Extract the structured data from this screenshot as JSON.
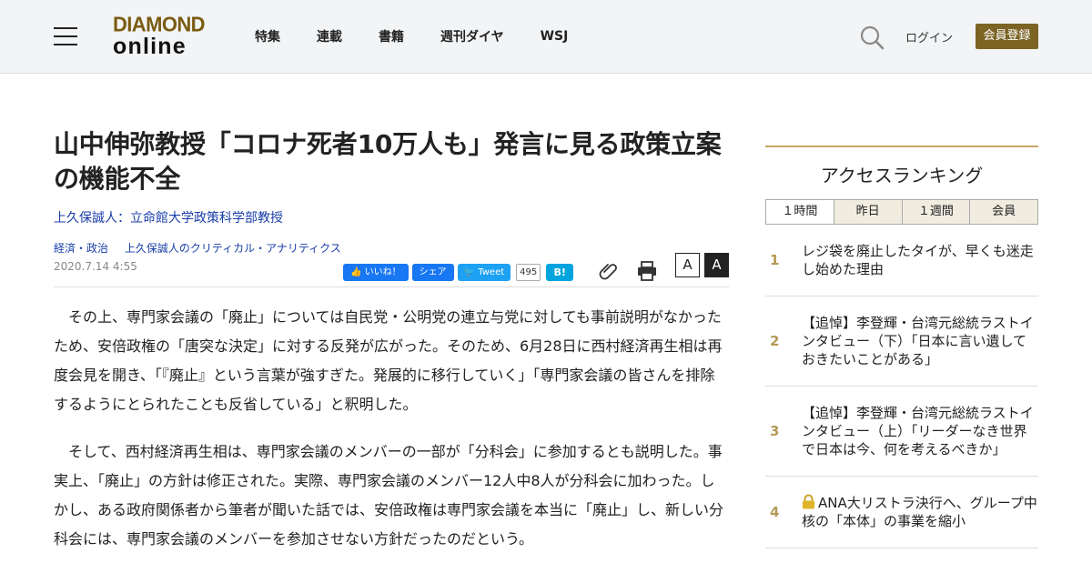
{
  "header": {
    "logo_top": "DIAMOND",
    "logo_bottom": "online",
    "nav": [
      "特集",
      "連載",
      "書籍",
      "週刊ダイヤ",
      "WSJ"
    ],
    "login": "ログイン",
    "register": "会員登録"
  },
  "article": {
    "title": "山中伸弥教授「コロナ死者10万人も」発言に見る政策立案の機能不全",
    "author": "上久保誠人：立命館大学政策科学部教授",
    "categories": [
      "経済・政治",
      "上久保誠人のクリティカル・アナリティクス"
    ],
    "date": "2020.7.14 4:55",
    "share": {
      "like": "いいね！",
      "share": "シェア",
      "tweet": "Tweet",
      "count": "495",
      "hatena": "B!"
    },
    "font_small": "A",
    "font_large": "A",
    "paragraphs": [
      "その上、専門家会議の「廃止」については自民党・公明党の連立与党に対しても事前説明がなかったため、安倍政権の「唐突な決定」に対する反発が広がった。そのため、6月28日に西村経済再生相は再度会見を開き、「『廃止』という言葉が強すぎた。発展的に移行していく」「専門家会議の皆さんを排除するようにとられたことも反省している」と釈明した。",
      "そして、西村経済再生相は、専門家会議のメンバーの一部が「分科会」に参加するとも説明した。事実上、「廃止」の方針は修正された。実際、専門家会議のメンバー12人中8人が分科会に加わった。しかし、ある政府関係者から筆者が聞いた話では、安倍政権は専門家会議を本当に「廃止」し、新しい分科会には、専門家会議のメンバーを参加させない方針だったのだという。"
    ]
  },
  "sidebar": {
    "heading": "アクセスランキング",
    "tabs": [
      "１時間",
      "昨日",
      "１週間",
      "会員"
    ],
    "ranking": [
      {
        "num": "1",
        "title": "レジ袋を廃止したタイが、早くも迷走し始めた理由",
        "locked": false
      },
      {
        "num": "2",
        "title": "【追悼】李登輝・台湾元総統ラストインタビュー（下）「日本に言い遺しておきたいことがある」",
        "locked": false
      },
      {
        "num": "3",
        "title": "【追悼】李登輝・台湾元総統ラストインタビュー（上）「リーダーなき世界で日本は今、何を考えるべきか」",
        "locked": false
      },
      {
        "num": "4",
        "title": "ANA大リストラ決行へ、グループ中核の「本体」の事業を縮小",
        "locked": true
      }
    ]
  },
  "colors": {
    "brand_gold": "#7b6424",
    "rank_gold": "#b49a55",
    "link_blue": "#1a3ea8"
  },
  "icons": [
    "hamburger-icon",
    "search-icon",
    "clip-icon",
    "print-icon",
    "lock-icon"
  ]
}
